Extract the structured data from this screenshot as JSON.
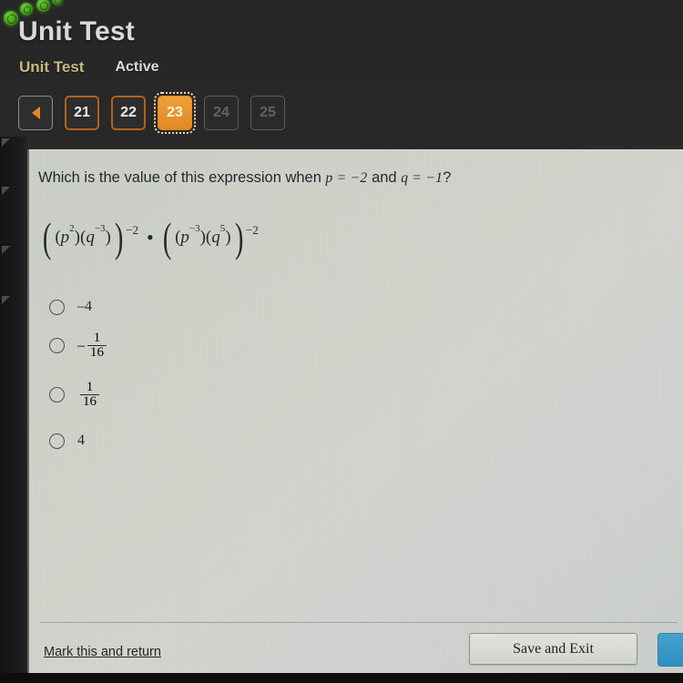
{
  "app": {
    "title": "Unit Test",
    "breadcrumb": {
      "unit_label": "Unit Test",
      "status_label": "Active"
    }
  },
  "pagination": {
    "prev_icon": "left-triangle-icon",
    "items": [
      {
        "label": "21",
        "state": "visited"
      },
      {
        "label": "22",
        "state": "visited"
      },
      {
        "label": "23",
        "state": "current"
      },
      {
        "label": "24",
        "state": "disabled"
      },
      {
        "label": "25",
        "state": "disabled"
      }
    ]
  },
  "question": {
    "prompt_prefix": "Which is the value of this expression when",
    "given_p": "p = −2",
    "and_word": "and",
    "given_q": "q = −1",
    "question_mark": "?",
    "expression": {
      "left": {
        "base_p": "p",
        "base_p_exp": "2",
        "base_q": "q",
        "base_q_exp": "−3",
        "outer_exp": "−2"
      },
      "operator": "•",
      "right": {
        "base_p": "p",
        "base_p_exp": "−3",
        "base_q": "q",
        "base_q_exp": "5",
        "outer_exp": "−2"
      }
    }
  },
  "options": [
    {
      "id": "opt-a",
      "type": "plain",
      "label": "–4",
      "selected": false
    },
    {
      "id": "opt-b",
      "type": "fraction",
      "sign": "–",
      "numerator": "1",
      "denominator": "16",
      "selected": false
    },
    {
      "id": "opt-c",
      "type": "fraction",
      "sign": "",
      "numerator": "1",
      "denominator": "16",
      "selected": false
    },
    {
      "id": "opt-d",
      "type": "plain",
      "label": "4",
      "selected": false
    }
  ],
  "footer": {
    "mark_link": "Mark this and return",
    "save_button": "Save and Exit",
    "next_button": ""
  },
  "colors": {
    "accent_orange": "#e08a22",
    "crumb_tan": "#c8b882",
    "next_blue": "#2f8fc0",
    "card_bg": "#d3d5cd",
    "chrome_bg": "#262626"
  },
  "icons": {
    "notification_badges": [
      "check-badge-icon",
      "check-badge-icon",
      "check-badge-icon",
      "check-badge-icon"
    ],
    "rail_markers": [
      "triangle-marker-icon",
      "triangle-marker-icon",
      "triangle-marker-icon",
      "triangle-marker-icon"
    ]
  }
}
